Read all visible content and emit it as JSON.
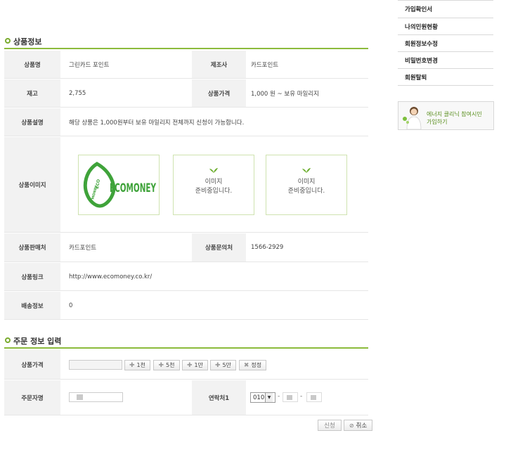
{
  "product_section": {
    "title": "상품정보",
    "rows": {
      "name_label": "상품명",
      "name_value": "그린카드 포인트",
      "maker_label": "제조사",
      "maker_value": "카드포인트",
      "stock_label": "재고",
      "stock_value": "2,755",
      "price_label": "상품가격",
      "price_value": "1,000 원 ~ 보유 마일리지",
      "desc_label": "상품설명",
      "desc_value": "해당 상품은 1,000원부터 보유 마일리지 전체까지 신청이 가능합니다.",
      "image_label": "상품이미지",
      "seller_label": "상품판매처",
      "seller_value": "카드포인트",
      "contact_label": "상품문의처",
      "contact_value": "1566-2929",
      "link_label": "상품링크",
      "link_value": "http://www.ecomoney.co.kr/",
      "shipping_label": "배송정보",
      "shipping_value": "0"
    },
    "images": {
      "logo_ring_top": "ECO",
      "logo_ring_bottom": "MONEY",
      "logo_text": "ECOMONEY",
      "placeholder_line1": "이미지",
      "placeholder_line2": "준비중입니다."
    }
  },
  "order_section": {
    "title": "주문 정보 입력",
    "price_label": "상품가격",
    "amount_buttons": [
      "1천",
      "5천",
      "1만",
      "5만"
    ],
    "reset_button": "정정",
    "orderer_label": "주문자명",
    "phone_label": "연락처1",
    "phone_prefix": "010",
    "submit_button": "신청",
    "cancel_button": "취소"
  },
  "sidebar": {
    "menu": [
      "가입확인서",
      "나의민원현황",
      "회원정보수정",
      "비밀번호변경",
      "회원탈퇴"
    ],
    "banner_line1": "에너지 클리닉 참여시민",
    "banner_line2": "가입하기"
  },
  "colors": {
    "accent_green": "#8cbb3c",
    "label_bg": "#f2f2f2",
    "banner_text": "#5a8f1e"
  }
}
